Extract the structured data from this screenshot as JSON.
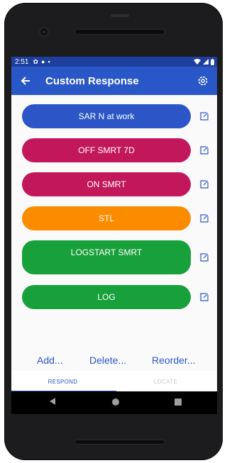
{
  "statusbar": {
    "time": "2:51"
  },
  "appbar": {
    "title": "Custom Response"
  },
  "responses": [
    {
      "label": "SAR N at work",
      "color": "#2c56c7"
    },
    {
      "label": "OFF SMRT 7D",
      "color": "#c2185b"
    },
    {
      "label": "ON SMRT",
      "color": "#c2185b"
    },
    {
      "label": "STL",
      "color": "#fb8c00"
    },
    {
      "label": "LOGSTART SMRT",
      "color": "#18a03a"
    },
    {
      "label": "LOG",
      "color": "#18a03a"
    }
  ],
  "actions": {
    "add": "Add...",
    "delete": "Delete...",
    "reorder": "Reorder..."
  },
  "tabs": {
    "respond": "RESPOND",
    "locate": "LOCATE"
  },
  "colors": {
    "primary": "#2a57c8",
    "status_bar": "#1e3f9d"
  }
}
